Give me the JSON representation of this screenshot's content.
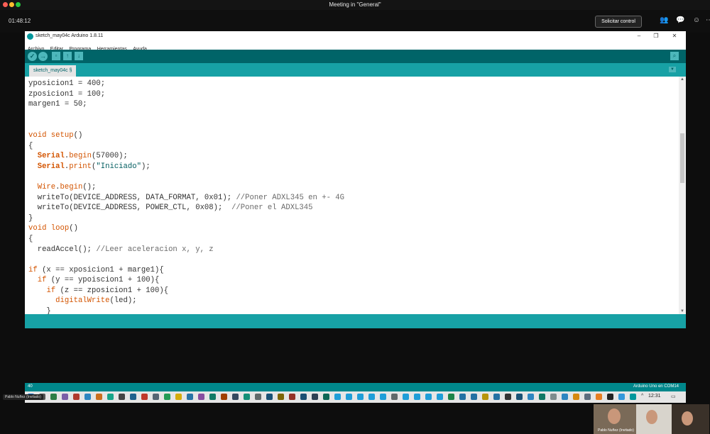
{
  "meeting": {
    "title": "Meeting in \"General\"",
    "elapsed": "01:48:12",
    "request_control_label": "Solicitar control",
    "participant_name": "Pablo Nuñez (Invitado)"
  },
  "window": {
    "title": "sketch_may04c Arduino 1.8.11",
    "menu": [
      "Archivo",
      "Editar",
      "Programa",
      "Herramientas",
      "Ayuda"
    ],
    "tab_label": "sketch_may04c §"
  },
  "editor": {
    "lines": [
      "yposicion1 = 400;",
      "zposicion1 = 100;",
      "margen1 = 50;",
      "",
      "",
      "void setup()",
      "{",
      "  Serial.begin(57000);",
      "  Serial.print(\"Iniciado\");",
      "",
      "  Wire.begin();",
      "  writeTo(DEVICE_ADDRESS, DATA_FORMAT, 0x01); //Poner ADXL345 en +- 4G",
      "  writeTo(DEVICE_ADDRESS, POWER_CTL, 0x08);  //Poner el ADXL345",
      "}",
      "void loop()",
      "{",
      "  readAccel(); //Leer aceleracion x, y, z",
      "",
      "if (x == xposicion1 + marge1){",
      "  if (y == ypoiscion1 + 100){",
      "    if (z == zposicion1 + 100){",
      "      digitalWrite(led);",
      "    }"
    ]
  },
  "status": {
    "line_number": "40",
    "board_port": "Arduino Uno en COM14"
  },
  "taskbar": {
    "time": "12:31"
  },
  "colors": {
    "arduino_dark_teal": "#006468",
    "arduino_teal": "#17a1a5",
    "keyword_orange": "#d35400",
    "highlight_yellow": "#f4d33d"
  }
}
